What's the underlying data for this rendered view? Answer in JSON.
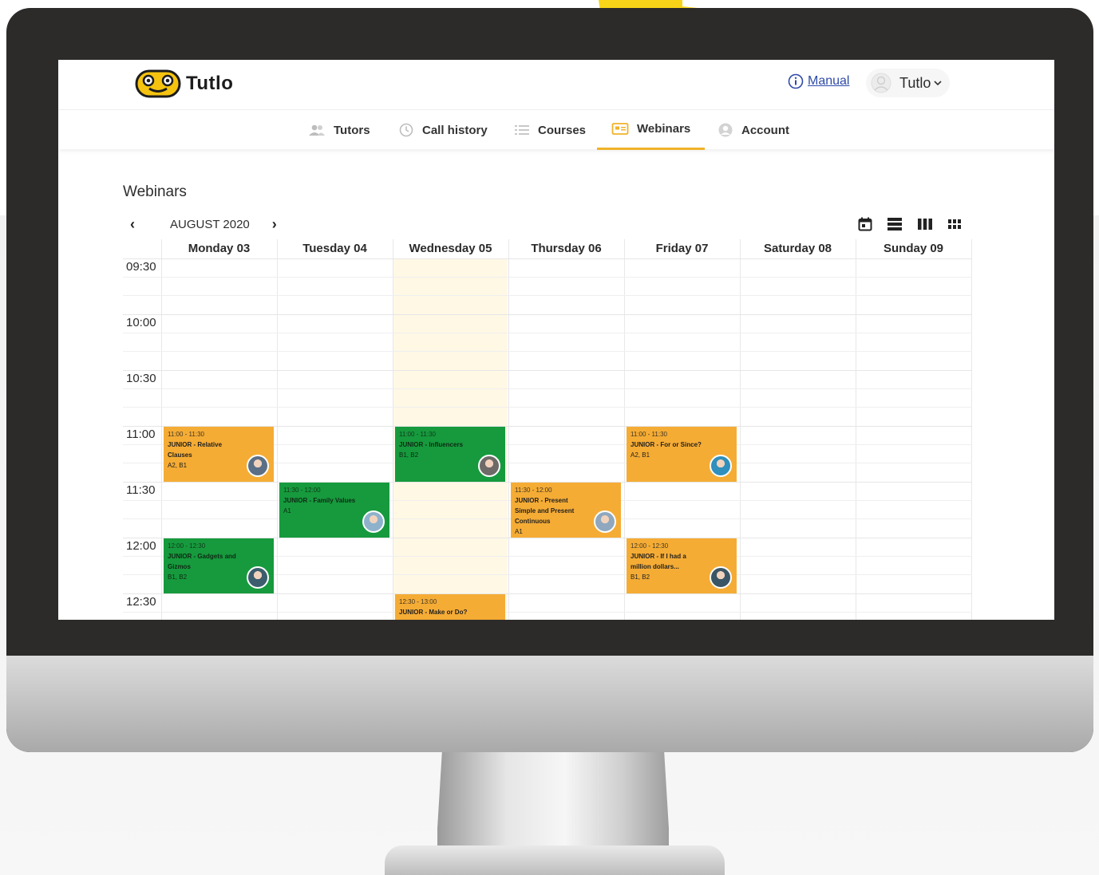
{
  "app": {
    "logo_text": "Tutlo",
    "manual_label": "Manual",
    "user_name": "Tutlo"
  },
  "nav": {
    "tabs": [
      {
        "label": "Tutors",
        "icon": "users-icon"
      },
      {
        "label": "Call history",
        "icon": "history-icon"
      },
      {
        "label": "Courses",
        "icon": "list-icon"
      },
      {
        "label": "Webinars",
        "icon": "webinar-icon",
        "active": true
      },
      {
        "label": "Account",
        "icon": "account-icon"
      }
    ]
  },
  "page": {
    "title": "Webinars",
    "month": "AUGUST 2020",
    "prev": "‹",
    "next": "›"
  },
  "calendar": {
    "days": [
      "Monday 03",
      "Tuesday 04",
      "Wednesday 05",
      "Thursday 06",
      "Friday 07",
      "Saturday 08",
      "Sunday 09"
    ],
    "times": [
      "09:30",
      "10:00",
      "10:30",
      "11:00",
      "11:30",
      "12:00",
      "12:30"
    ],
    "events": [
      {
        "day": 0,
        "slot": 3,
        "color": "orange",
        "time": "11:00 - 11:30",
        "title": "JUNIOR - Relative Clauses",
        "levels": "A2, B1",
        "avatar": "#5b6f86"
      },
      {
        "day": 2,
        "slot": 3,
        "color": "green",
        "time": "11:00 - 11:30",
        "title": "JUNIOR - Influencers",
        "levels": "B1, B2",
        "avatar": "#6d6a68"
      },
      {
        "day": 4,
        "slot": 3,
        "color": "orange",
        "time": "11:00 - 11:30",
        "title": "JUNIOR - For or Since?",
        "levels": "A2, B1",
        "avatar": "#2f8fbd"
      },
      {
        "day": 1,
        "slot": 4,
        "color": "green",
        "time": "11:30 - 12:00",
        "title": "JUNIOR - Family Values",
        "levels": "A1",
        "avatar": "#8fb2cc"
      },
      {
        "day": 3,
        "slot": 4,
        "color": "orange",
        "time": "11:30 - 12:00",
        "title": "JUNIOR - Present Simple and Present Continuous",
        "levels": "A1",
        "avatar": "#8fa8bf"
      },
      {
        "day": 0,
        "slot": 5,
        "color": "green",
        "time": "12:00 - 12:30",
        "title": "JUNIOR - Gadgets and Gizmos",
        "levels": "B1, B2",
        "avatar": "#3b5d6e"
      },
      {
        "day": 4,
        "slot": 5,
        "color": "orange",
        "time": "12:00 - 12:30",
        "title": "JUNIOR - If I had a million dollars...",
        "levels": "B1, B2",
        "avatar": "#3a5566"
      },
      {
        "day": 2,
        "slot": 6,
        "color": "orange",
        "time": "12:30 - 13:00",
        "title": "JUNIOR - Make or Do?",
        "levels": "",
        "avatar": ""
      }
    ]
  },
  "colors": {
    "accent": "#f0b22a",
    "event_orange": "#f5ac35",
    "event_green": "#169a3d",
    "arrow_yellow": "#f7d417",
    "today_bg": "#fff8e5"
  }
}
